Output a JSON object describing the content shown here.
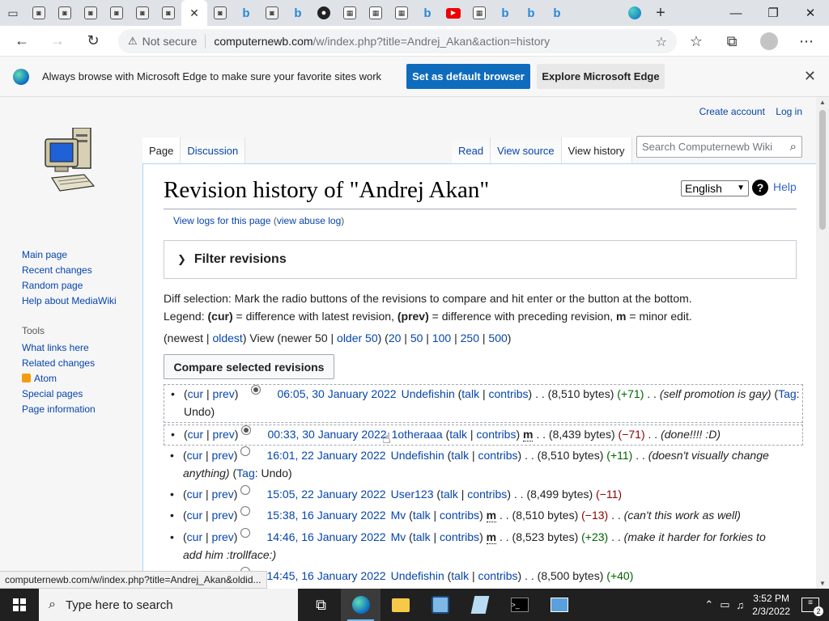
{
  "browser": {
    "tabs_count": 25,
    "new_tab": "+",
    "back": "←",
    "forward": "→",
    "reload": "↻",
    "not_secure": "Not secure",
    "url_host": "computernewb.com",
    "url_path": "/w/index.php?title=Andrej_Akan&action=history"
  },
  "infobar": {
    "message": "Always browse with Microsoft Edge to make sure your favorite sites work",
    "primary_button": "Set as default browser",
    "secondary_button": "Explore Microsoft Edge"
  },
  "wiki": {
    "personal": {
      "create_account": "Create account",
      "login": "Log in"
    },
    "tabs_left": [
      "Page",
      "Discussion"
    ],
    "tabs_right": [
      "Read",
      "View source",
      "View history"
    ],
    "search_placeholder": "Search Computernewb Wiki",
    "sidebar_main": [
      "Main page",
      "Recent changes",
      "Random page",
      "Help about MediaWiki"
    ],
    "tools_heading": "Tools",
    "sidebar_tools": [
      "What links here",
      "Related changes",
      "Atom",
      "Special pages",
      "Page information"
    ],
    "title": "Revision history of \"Andrej Akan\"",
    "language": "English",
    "help": "Help",
    "subtitle_logs": "View logs for this page",
    "subtitle_abuse": "view abuse log",
    "filter_label": "Filter revisions",
    "desc_line1": "Diff selection: Mark the radio buttons of the revisions to compare and hit enter or the button at the bottom.",
    "legend": {
      "prefix": "Legend: ",
      "cur": "(cur)",
      "cur_text": " = difference with latest revision, ",
      "prev": "(prev)",
      "prev_text": " = difference with preceding revision, ",
      "m": "m",
      "m_text": " = minor edit."
    },
    "pager": {
      "newest": "newest",
      "oldest": "oldest",
      "view": "View (newer 50 | ",
      "older": "older 50",
      "counts": [
        "20",
        "50",
        "100",
        "250",
        "500"
      ]
    },
    "compare_button": "Compare selected revisions",
    "revisions": [
      {
        "date": "06:05, 30 January 2022",
        "user": "Undefishin",
        "minor": false,
        "bytes": "(8,510 bytes)",
        "diff": "(+71)",
        "diff_sign": "pos",
        "summary": "(self promotion is gay)",
        "tag": "Undo",
        "radio_left": "checked",
        "radio_right": "none"
      },
      {
        "date": "00:33, 30 January 2022",
        "user": "1otheraaa",
        "minor": true,
        "bytes": "(8,439 bytes)",
        "diff": "(−71)",
        "diff_sign": "neg",
        "summary": "(done!!!! :D)",
        "tag": "",
        "radio_left": "none",
        "radio_right": "checked"
      },
      {
        "date": "16:01, 22 January 2022",
        "user": "Undefishin",
        "minor": false,
        "bytes": "(8,510 bytes)",
        "diff": "(+11)",
        "diff_sign": "pos",
        "summary": "(doesn't visually change anything)",
        "tag": "Undo",
        "radio_left": "none",
        "radio_right": "empty"
      },
      {
        "date": "15:05, 22 January 2022",
        "user": "User123",
        "minor": false,
        "bytes": "(8,499 bytes)",
        "diff": "(−11)",
        "diff_sign": "neg",
        "summary": "",
        "tag": "",
        "radio_left": "none",
        "radio_right": "empty"
      },
      {
        "date": "15:38, 16 January 2022",
        "user": "Mv",
        "minor": true,
        "bytes": "(8,510 bytes)",
        "diff": "(−13)",
        "diff_sign": "neg",
        "summary": "(can't this work as well)",
        "tag": "",
        "radio_left": "none",
        "radio_right": "empty"
      },
      {
        "date": "14:46, 16 January 2022",
        "user": "Mv",
        "minor": true,
        "bytes": "(8,523 bytes)",
        "diff": "(+23)",
        "diff_sign": "pos",
        "summary": "(make it harder for forkies to add him :trollface:)",
        "tag": "",
        "radio_left": "none",
        "radio_right": "empty"
      },
      {
        "date": "14:45, 16 January 2022",
        "user": "Undefishin",
        "minor": false,
        "bytes": "(8,500 bytes)",
        "diff": "(+40)",
        "diff_sign": "pos",
        "summary": "",
        "tag": "",
        "radio_left": "none",
        "radio_right": "empty"
      }
    ],
    "labels": {
      "cur": "cur",
      "prev": "prev",
      "talk": "talk",
      "contribs": "contribs",
      "tag": "Tag",
      "m": "m"
    }
  },
  "status_url": "computernewb.com/w/index.php?title=Andrej_Akan&oldid...",
  "taskbar": {
    "search_placeholder": "Type here to search",
    "time": "3:52 PM",
    "date": "2/3/2022",
    "notifications": "2"
  }
}
